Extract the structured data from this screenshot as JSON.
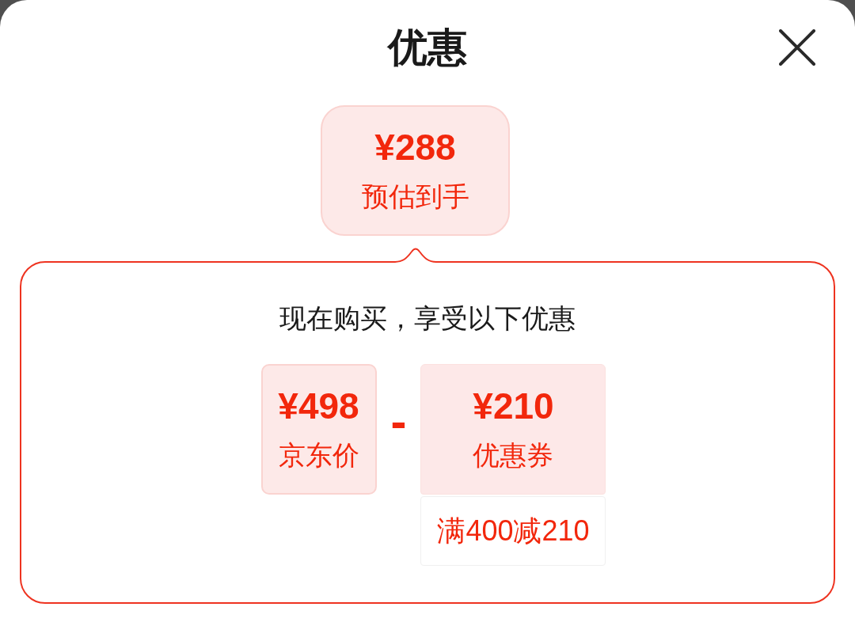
{
  "sheet": {
    "title": "优惠"
  },
  "estimate": {
    "amount": "¥288",
    "label": "预估到手"
  },
  "breakdown": {
    "heading": "现在购买，享受以下优惠",
    "items": [
      {
        "kind": "price",
        "amount": "¥498",
        "label": "京东价"
      },
      {
        "kind": "operator",
        "symbol": "-"
      },
      {
        "kind": "coupon",
        "amount": "¥210",
        "label": "优惠券",
        "condition": "满400减210"
      }
    ]
  }
}
